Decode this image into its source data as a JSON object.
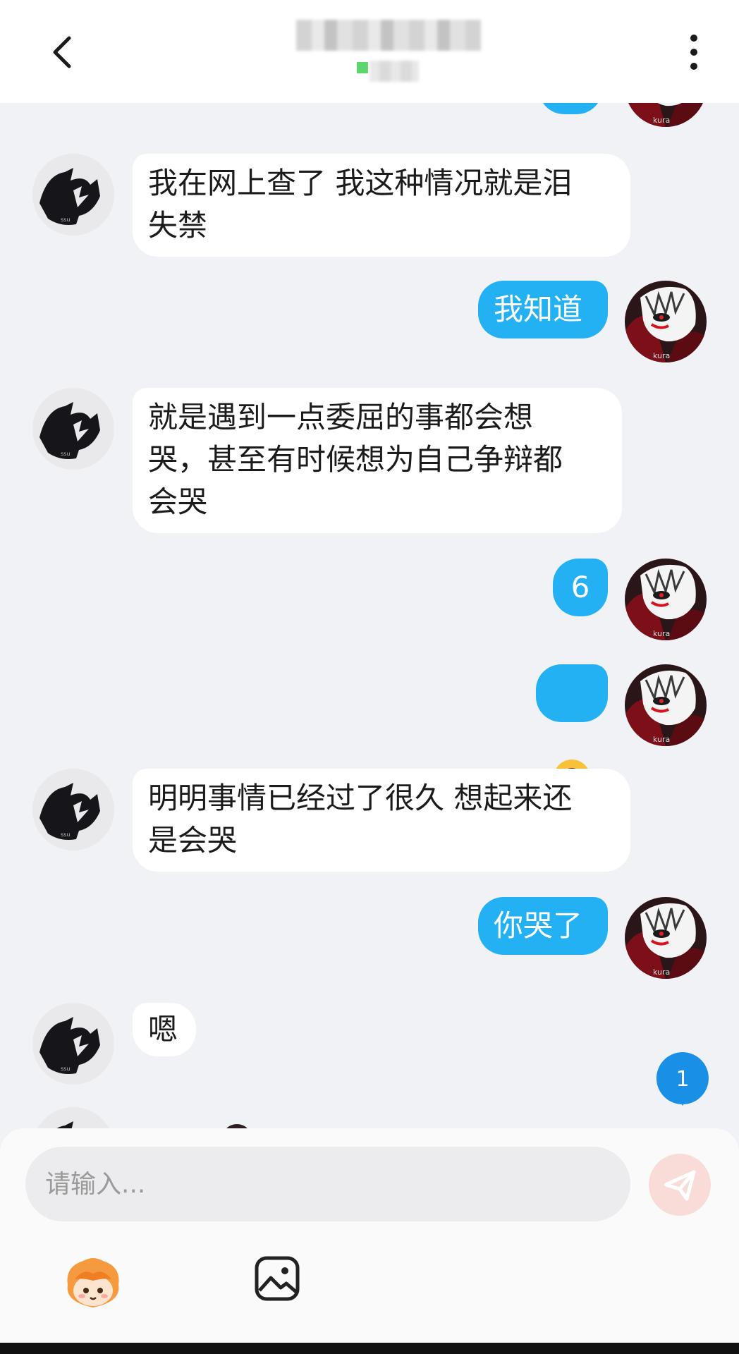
{
  "header": {
    "back_icon": "chevron-left-icon",
    "more_icon": "more-vertical-icon",
    "status_color": "#5ed66f"
  },
  "messages": [
    {
      "side": "in",
      "text": "我在网上查了 我这种情况就是泪\n失禁"
    },
    {
      "side": "out",
      "text": "我知道"
    },
    {
      "side": "in",
      "text": "就是遇到一点委屈的事都会想\n哭，甚至有时候想为自己争辩都\n会哭"
    },
    {
      "side": "out",
      "text": "6"
    },
    {
      "side": "out",
      "emoji": "upside-down-face-emoji"
    },
    {
      "side": "in",
      "text": "明明事情已经过了很久 想起来还\n是会哭"
    },
    {
      "side": "out",
      "text": "你哭了"
    },
    {
      "side": "in",
      "text": "嗯"
    }
  ],
  "unread_badge": {
    "count": "1",
    "color": "#1a8fe6"
  },
  "composer": {
    "placeholder": "请输入...",
    "send_icon": "send-icon",
    "sticker_icon": "sticker-icon",
    "image_icon": "image-icon",
    "accent_color": "#24b1f3"
  }
}
